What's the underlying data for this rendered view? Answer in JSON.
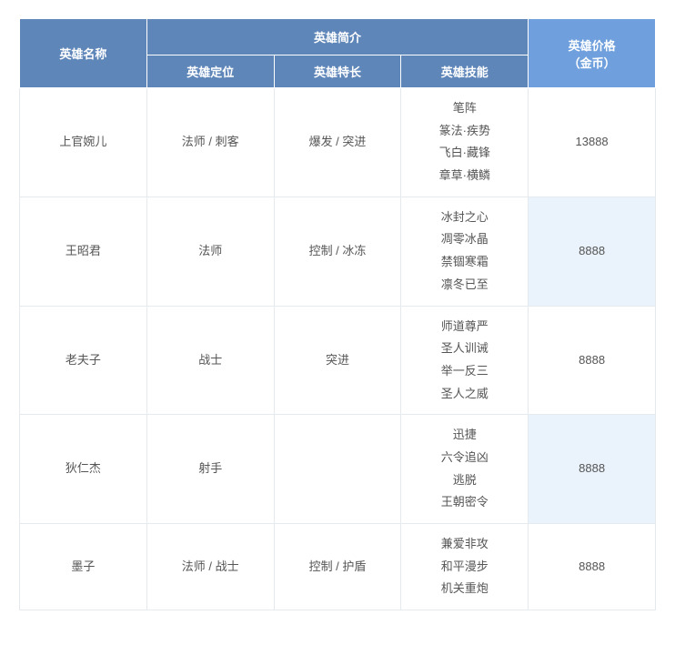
{
  "table": {
    "header": {
      "name": "英雄名称",
      "intro": "英雄简介",
      "role": "英雄定位",
      "specialty": "英雄特长",
      "skills": "英雄技能",
      "price": "英雄价格",
      "price_unit": "（金币）"
    },
    "rows": [
      {
        "name": "上官婉儿",
        "role": "法师 / 刺客",
        "specialty": "爆发 / 突进",
        "skills": [
          "笔阵",
          "篆法·疾势",
          "飞白·藏锋",
          "章草·横鳞"
        ],
        "price": "13888"
      },
      {
        "name": "王昭君",
        "role": "法师",
        "specialty": "控制 / 冰冻",
        "skills": [
          "冰封之心",
          "凋零冰晶",
          "禁锢寒霜",
          "凛冬已至"
        ],
        "price": "8888"
      },
      {
        "name": "老夫子",
        "role": "战士",
        "specialty": "突进",
        "skills": [
          "师道尊严",
          "圣人训诫",
          "举一反三",
          "圣人之威"
        ],
        "price": "8888"
      },
      {
        "name": "狄仁杰",
        "role": "射手",
        "specialty": "",
        "skills": [
          "迅捷",
          "六令追凶",
          "逃脱",
          "王朝密令"
        ],
        "price": "8888"
      },
      {
        "name": "墨子",
        "role": "法师 / 战士",
        "specialty": "控制 / 护盾",
        "skills": [
          "兼爱非攻",
          "和平漫步",
          "机关重炮",
          ""
        ],
        "price": "8888"
      }
    ]
  }
}
